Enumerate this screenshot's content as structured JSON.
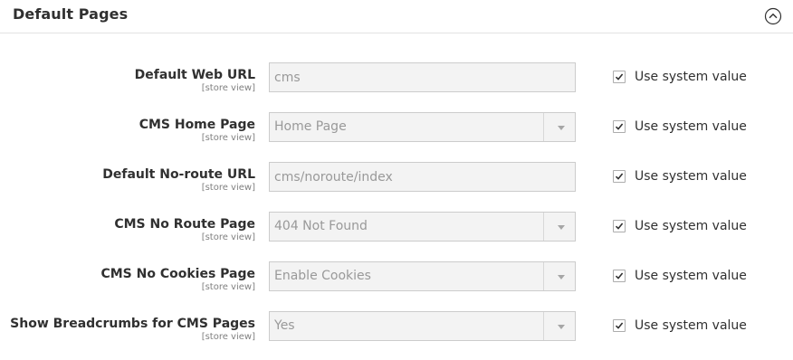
{
  "section": {
    "title": "Default Pages",
    "collapse_icon": "chevron-up-circle-icon"
  },
  "fields": [
    {
      "label": "Default Web URL",
      "scope": "[store view]",
      "type": "text",
      "value": "cms",
      "use_system_value": true
    },
    {
      "label": "CMS Home Page",
      "scope": "[store view]",
      "type": "select",
      "value": "Home Page",
      "use_system_value": true
    },
    {
      "label": "Default No-route URL",
      "scope": "[store view]",
      "type": "text",
      "value": "cms/noroute/index",
      "use_system_value": true
    },
    {
      "label": "CMS No Route Page",
      "scope": "[store view]",
      "type": "select",
      "value": "404 Not Found",
      "use_system_value": true
    },
    {
      "label": "CMS No Cookies Page",
      "scope": "[store view]",
      "type": "select",
      "value": "Enable Cookies",
      "use_system_value": true
    },
    {
      "label": "Show Breadcrumbs for CMS Pages",
      "scope": "[store view]",
      "type": "select",
      "value": "Yes",
      "use_system_value": true
    }
  ],
  "use_system_value_label": "Use system value",
  "colors": {
    "text": "#303030",
    "scope": "#808080",
    "field_bg": "#f3f3f3",
    "field_border": "#cccccc",
    "disabled_text": "#999999"
  }
}
